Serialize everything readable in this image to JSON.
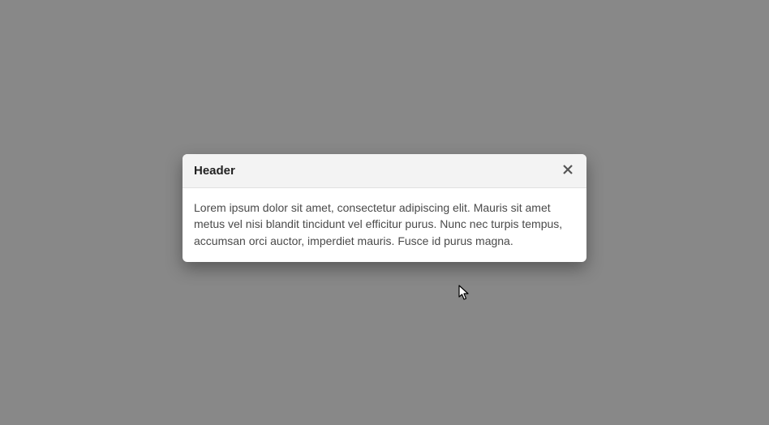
{
  "dialog": {
    "title": "Header",
    "body": "Lorem ipsum dolor sit amet, consectetur adipiscing elit. Mauris sit amet metus vel nisi blandit tincidunt vel efficitur purus. Nunc nec turpis tempus, accumsan orci auctor, imperdiet mauris. Fusce id purus magna."
  }
}
